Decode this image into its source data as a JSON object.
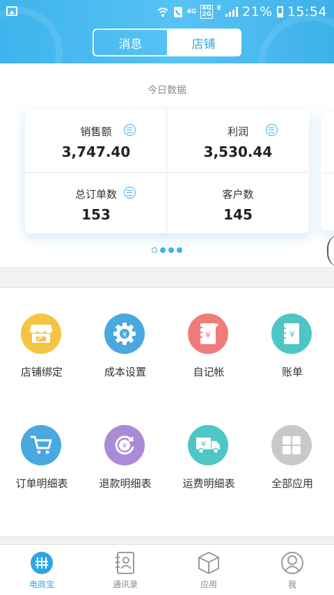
{
  "status_bar": {
    "network_small": "4G",
    "network_stack": [
      "4G",
      "2G"
    ],
    "network_e": "E",
    "battery": "21%",
    "time": "15:54"
  },
  "header": {
    "tabs": [
      {
        "label": "消息",
        "selected": false
      },
      {
        "label": "店铺",
        "selected": true
      }
    ]
  },
  "today": {
    "title": "今日数据",
    "stats": [
      {
        "label": "销售额",
        "value": "3,747.40",
        "has_list_icon": true
      },
      {
        "label": "利润",
        "value": "3,530.44",
        "has_list_icon": true
      },
      {
        "label": "总订单数",
        "value": "153",
        "has_list_icon": true
      },
      {
        "label": "客户数",
        "value": "145",
        "has_list_icon": false
      }
    ],
    "pager": {
      "count": 4,
      "current": 1
    }
  },
  "apps": [
    {
      "label": "店铺绑定",
      "icon": "store-icon",
      "color": "#f6c443"
    },
    {
      "label": "成本设置",
      "icon": "gear-yuan-icon",
      "color": "#4aa8e0"
    },
    {
      "label": "自记帐",
      "icon": "notebook-yuan-icon",
      "color": "#ef7b7b"
    },
    {
      "label": "账单",
      "icon": "bill-icon",
      "color": "#4fc6c6"
    },
    {
      "label": "订单明细表",
      "icon": "cart-icon",
      "color": "#4aa8e0"
    },
    {
      "label": "退款明细表",
      "icon": "refund-icon",
      "color": "#a98bd8"
    },
    {
      "label": "运费明细表",
      "icon": "truck-icon",
      "color": "#4fc6c6"
    },
    {
      "label": "全部应用",
      "icon": "grid-icon",
      "color": "#c9c9c9"
    }
  ],
  "bottom_nav": [
    {
      "label": "电商宝",
      "icon": "home-abacus-icon",
      "active": true
    },
    {
      "label": "通讯录",
      "icon": "contacts-icon",
      "active": false
    },
    {
      "label": "应用",
      "icon": "cube-icon",
      "active": false
    },
    {
      "label": "我",
      "icon": "user-icon",
      "active": false
    }
  ],
  "colors": {
    "accent": "#2ea6e4",
    "header_bg": "#45b6ef"
  }
}
